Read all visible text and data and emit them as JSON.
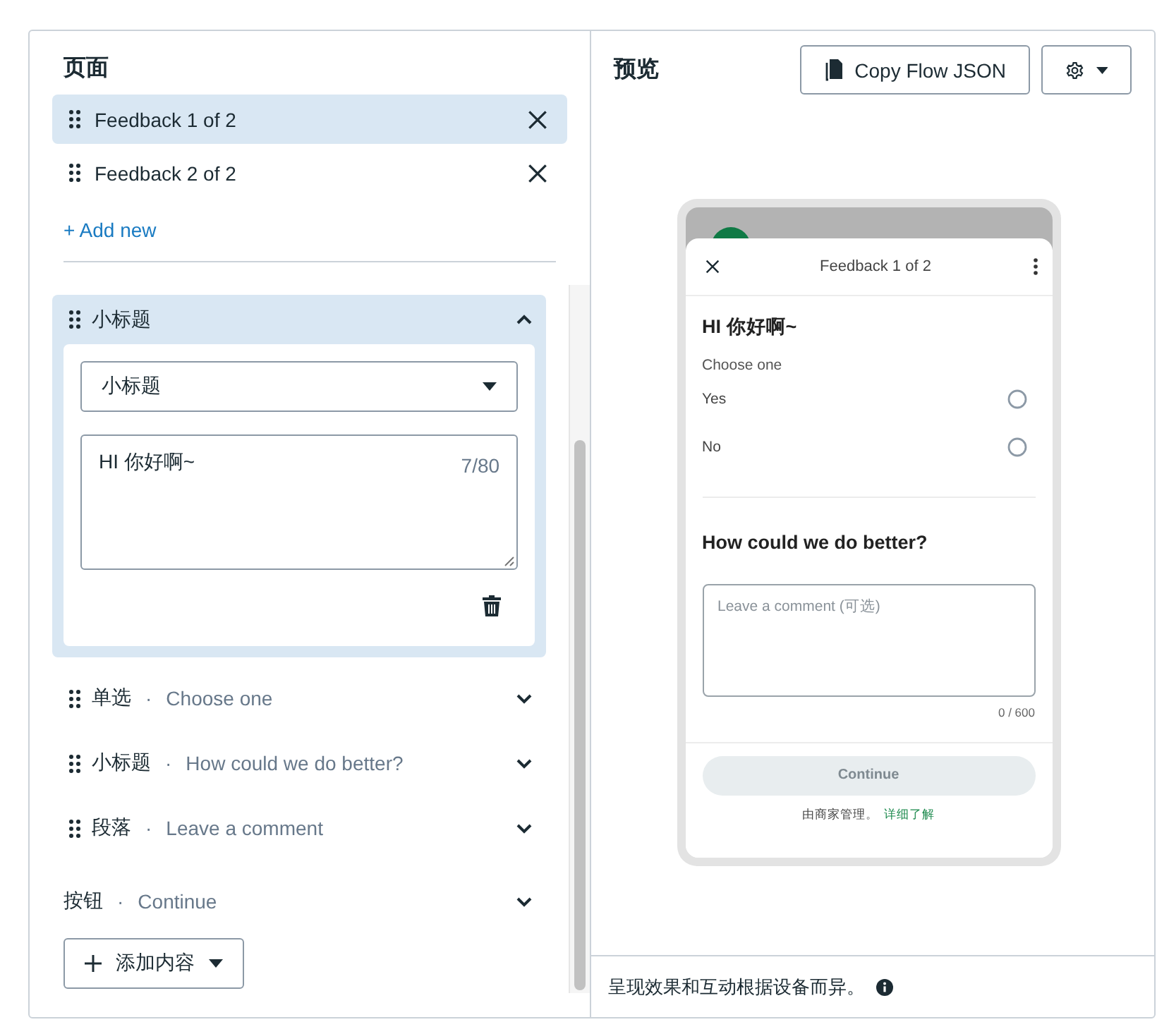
{
  "pages_panel": {
    "title": "页面",
    "pages": [
      {
        "label": "Feedback 1 of 2",
        "selected": true
      },
      {
        "label": "Feedback 2 of 2",
        "selected": false
      }
    ],
    "add_link": "+ Add new",
    "content_items": [
      {
        "kind": "block",
        "type": "小标题",
        "expanded": true,
        "select_value": "小标题",
        "text_value": "HI 你好啊~",
        "counter": "7/80"
      },
      {
        "kind": "block",
        "type": "单选",
        "separator": "·",
        "summary": "Choose one",
        "expanded": false
      },
      {
        "kind": "block",
        "type": "小标题",
        "separator": "·",
        "summary": "How could we do better?",
        "expanded": false
      },
      {
        "kind": "block",
        "type": "段落",
        "separator": "·",
        "summary": "Leave a comment",
        "expanded": false
      },
      {
        "kind": "button",
        "type": "按钮",
        "separator": "·",
        "summary": "Continue",
        "expanded": false
      }
    ],
    "add_content_button": "添加内容"
  },
  "preview": {
    "title": "预览",
    "copy_button": "Copy Flow JSON",
    "phone": {
      "title": "Feedback 1 of 2",
      "heading": "HI 你好啊~",
      "radio_label": "Choose one",
      "options": [
        {
          "label": "Yes",
          "selected": false
        },
        {
          "label": "No",
          "selected": false
        }
      ],
      "subheading": "How could we do better?",
      "comment_placeholder": "Leave a comment (可选)",
      "comment_counter": "0 / 600",
      "continue_button": {
        "label": "Continue",
        "disabled": true
      },
      "footer_text": "由商家管理。",
      "footer_link": "详细了解"
    },
    "note": "呈现效果和互动根据设备而异。"
  }
}
